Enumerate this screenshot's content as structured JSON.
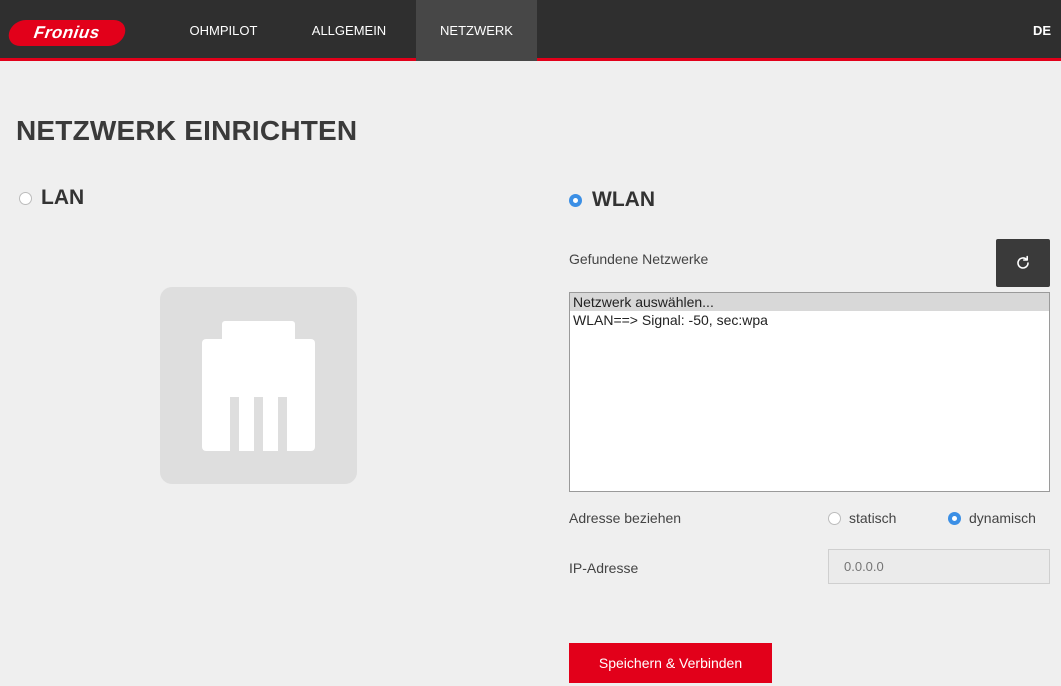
{
  "header": {
    "logo_text": "Fronius",
    "nav": [
      {
        "label": "OHMPILOT"
      },
      {
        "label": "ALLGEMEIN"
      },
      {
        "label": "NETZWERK"
      }
    ],
    "language": "DE"
  },
  "page": {
    "title": "NETZWERK EINRICHTEN"
  },
  "lan": {
    "label": "LAN",
    "selected": false,
    "icon": "ethernet-port-icon"
  },
  "wlan": {
    "label": "WLAN",
    "selected": true,
    "found_networks_label": "Gefundene Netzwerke",
    "refresh_icon": "refresh-icon",
    "networks": [
      {
        "label": "Netzwerk auswählen..."
      },
      {
        "label": "WLAN==> Signal: -50, sec:wpa"
      }
    ],
    "address_label": "Adresse beziehen",
    "address_options": [
      {
        "label": "statisch",
        "selected": false
      },
      {
        "label": "dynamisch",
        "selected": true
      }
    ],
    "ip_label": "IP-Adresse",
    "ip_placeholder": "0.0.0.0",
    "save_label": "Speichern & Verbinden"
  },
  "colors": {
    "accent": "#e2001a",
    "topbar": "#2f2f2f",
    "radio_active": "#3b8fe5",
    "background": "#efefef"
  }
}
